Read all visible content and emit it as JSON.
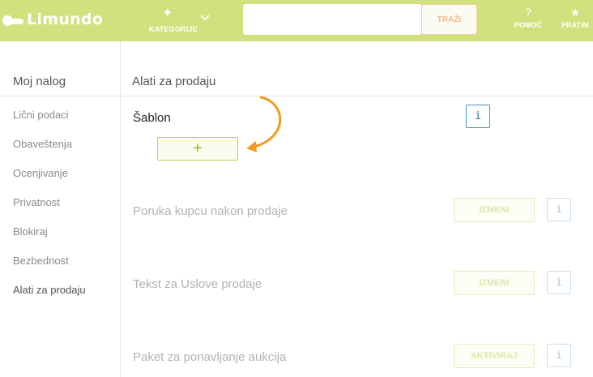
{
  "header": {
    "logo_text": "Limundo",
    "kategorije_label": "KATEGORIJE",
    "search_placeholder": "",
    "search_button": "TRAŽI",
    "pomoc_label": "POMOĆ",
    "pomoc_icon": "?",
    "pratim_label": "PRATIM",
    "pratim_icon": "★",
    "kategorije_icon": "✦",
    "brand_color": "#d3e07e"
  },
  "sidebar": {
    "title": "Moj nalog",
    "items": [
      {
        "label": "Lični podaci"
      },
      {
        "label": "Obaveštenja"
      },
      {
        "label": "Ocenjivanje"
      },
      {
        "label": "Privatnost"
      },
      {
        "label": "Blokiraj"
      },
      {
        "label": "Bezbednost"
      },
      {
        "label": "Alati za prodaju"
      }
    ]
  },
  "main": {
    "title": "Alati za prodaju",
    "sablon": {
      "label": "Šablon",
      "add_icon": "+",
      "info_icon": "i"
    },
    "rows": [
      {
        "label": "Poruka kupcu nakon prodaje",
        "button": "IZMENI",
        "info_icon": "i"
      },
      {
        "label": "Tekst za Uslove prodaje",
        "button": "IZMENI",
        "info_icon": "i"
      },
      {
        "label": "Paket za ponavljanje aukcija",
        "button": "AKTIVIRAJ",
        "info_icon": "i"
      }
    ]
  },
  "colors": {
    "accent_green": "#98b82a",
    "info_blue": "#4a90c4",
    "arrow_orange": "#f29a1f"
  }
}
